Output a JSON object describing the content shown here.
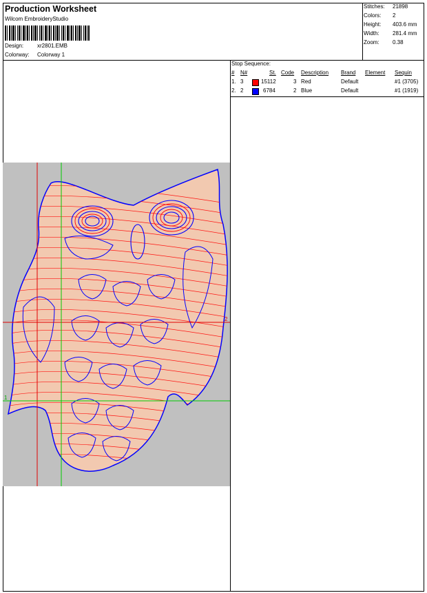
{
  "header": {
    "title": "Production Worksheet",
    "software": "Wilcom EmbroideryStudio",
    "design_label": "Design:",
    "design_value": "xr2801.EMB",
    "colorway_label": "Colorway:",
    "colorway_value": "Colorway 1"
  },
  "stats": [
    {
      "label": "Stitches:",
      "value": "21898"
    },
    {
      "label": "Colors:",
      "value": "2"
    },
    {
      "label": "Height:",
      "value": "403.6 mm"
    },
    {
      "label": "Width:",
      "value": "281.4 mm"
    },
    {
      "label": "Zoom:",
      "value": "0.38"
    }
  ],
  "stop_sequence": {
    "title": "Stop Sequence:",
    "headers": [
      "#",
      "N#",
      "St.",
      "Code",
      "Description",
      "Brand",
      "Element",
      "Sequin"
    ],
    "rows": [
      {
        "num": "1.",
        "n": "3",
        "color": "#ff0000",
        "st": "15112",
        "code": "3",
        "description": "Red",
        "brand": "Default",
        "sequin": "#1 (3705)"
      },
      {
        "num": "2.",
        "n": "2",
        "color": "#0000ff",
        "st": "6784",
        "code": "2",
        "description": "Blue",
        "brand": "Default",
        "sequin": "#1 (1919)"
      }
    ]
  },
  "guides": {
    "vertical_label": "1",
    "horizontal_label": "2"
  },
  "colors": {
    "background": "#c0c0c0",
    "red": "#ff0000",
    "blue": "#0000ff",
    "green_guide": "#00cc00",
    "red_guide": "#e00000"
  }
}
